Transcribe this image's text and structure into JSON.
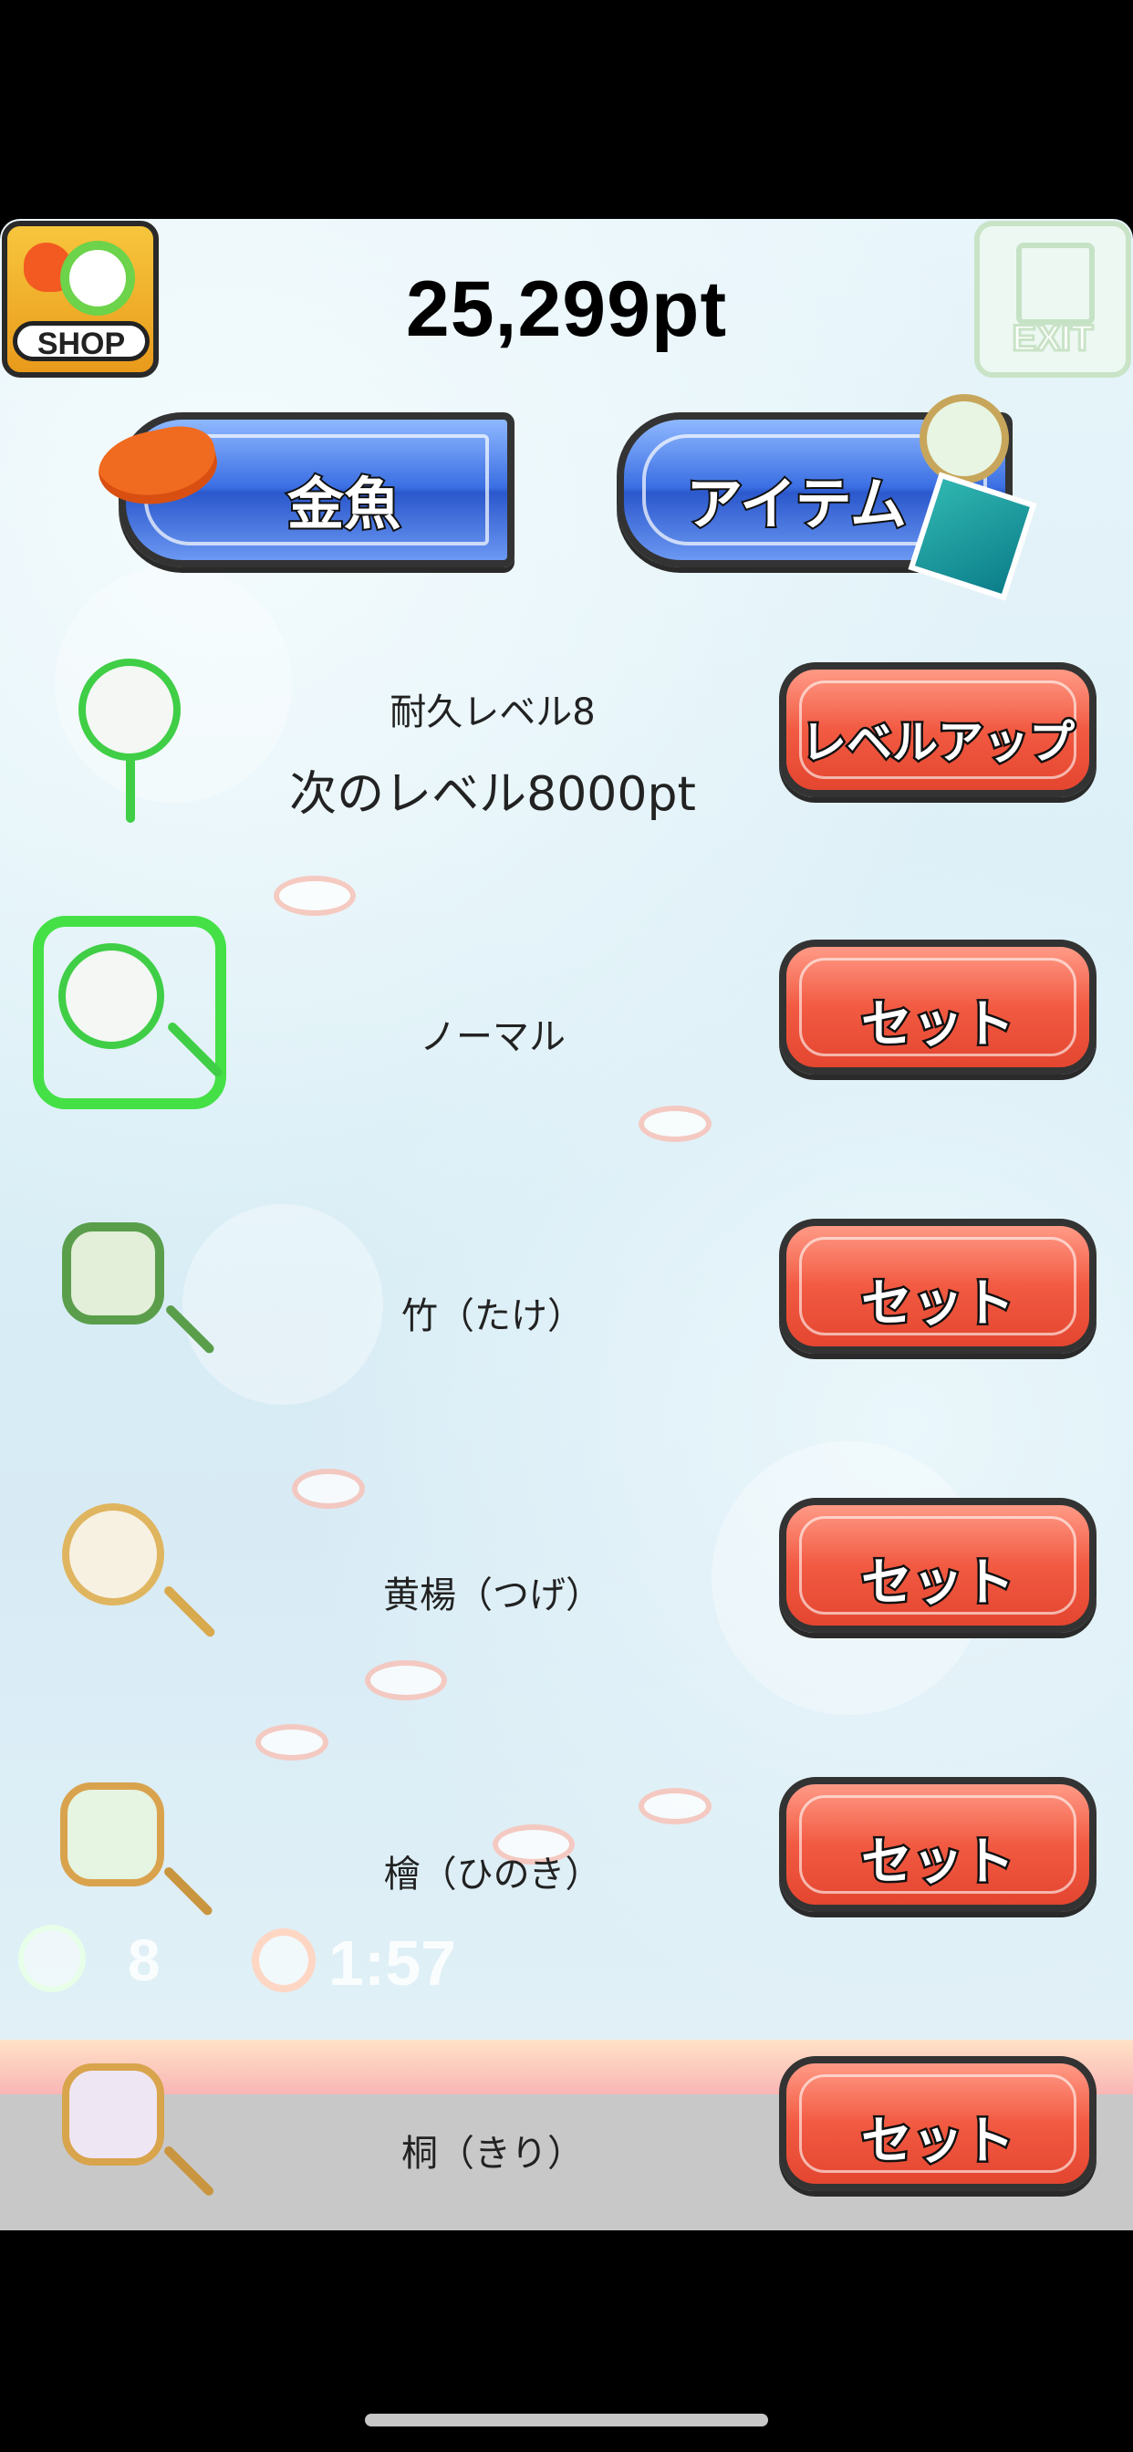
{
  "header": {
    "points": "25,299pt",
    "shop_label": "SHOP",
    "exit_label": "EXIT"
  },
  "tabs": {
    "kingyo": "金魚",
    "item": "アイテム"
  },
  "upgrade": {
    "durability_label": "耐久レベル8",
    "next_level_label": "次のレベル8000pt",
    "button_label": "レベルアップ"
  },
  "nets": [
    {
      "name": "ノーマル",
      "button_label": "セット",
      "selected": true,
      "icon": "green-poi-icon"
    },
    {
      "name": "竹（たけ）",
      "button_label": "セット",
      "selected": false,
      "icon": "bamboo-poi-icon"
    },
    {
      "name": "黄楊（つげ）",
      "button_label": "セット",
      "selected": false,
      "icon": "boxwood-poi-icon"
    },
    {
      "name": "檜（ひのき）",
      "button_label": "セット",
      "selected": false,
      "icon": "cypress-poi-icon"
    },
    {
      "name": "桐（きり）",
      "button_label": "セット",
      "selected": false,
      "icon": "paulownia-poi-icon"
    }
  ],
  "hud": {
    "net_count": "8",
    "timer": "1:57"
  },
  "colors": {
    "action_red": "#f25a42",
    "tab_blue": "#3b6fe3",
    "selected_green": "#44e046"
  }
}
